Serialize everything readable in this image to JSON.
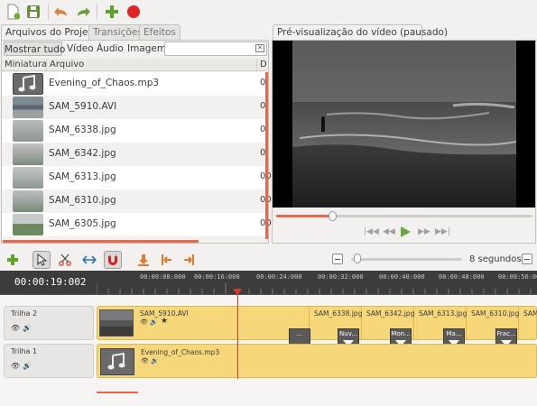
{
  "project_files": {
    "tabs": [
      "Arquivos do Projeto",
      "Transições",
      "Efeitos"
    ],
    "filters": [
      "Mostrar tudo",
      "Vídeo",
      "Áudio",
      "Imagem"
    ],
    "search_placeholder": "",
    "columns": [
      "Miniatura",
      "Arquivo",
      "D"
    ],
    "files": [
      {
        "name": "Evening_of_Chaos.mp3",
        "date": "0",
        "thumb": "audio-icon"
      },
      {
        "name": "SAM_5910.AVI",
        "date": "0",
        "thumb": "video"
      },
      {
        "name": "SAM_6338.jpg",
        "date": "0",
        "thumb": "image"
      },
      {
        "name": "SAM_6342.jpg",
        "date": "0",
        "thumb": "image"
      },
      {
        "name": "SAM_6313.jpg",
        "date": "00",
        "thumb": "image"
      },
      {
        "name": "SAM_6310.jpg",
        "date": "00",
        "thumb": "image"
      },
      {
        "name": "SAM_6305.jpg",
        "date": "00",
        "thumb": "image"
      }
    ]
  },
  "preview": {
    "tab_label": "Pré-visualização do vídeo (pausado)",
    "progress": 0.22
  },
  "timeline": {
    "current_time": "00:00:19:002",
    "zoom_label": "8 segundos",
    "zoom_level": 0.06,
    "ruler_marks": [
      "00:00:08:000",
      "00:00:16:000",
      "00:00:24:000",
      "00:00:32:000",
      "00:00:40:000",
      "00:00:48:000",
      "00:00:56:000"
    ],
    "tracks": [
      {
        "name": "Trilha 2",
        "clips": [
          "SAM_5910.AVI",
          "SAM_6338.jpg",
          "SAM_6342.jpg",
          "SAM_6313.jpg",
          "SAM_6310.jpg",
          "SAM_"
        ],
        "transitions": [
          "...",
          "Nuv...",
          "Mon...",
          "Ma...",
          "Frac..."
        ]
      },
      {
        "name": "Trilha 1",
        "clips": [
          "Evening_of_Chaos.mp3"
        ]
      }
    ]
  },
  "colors": {
    "accent": "#e9664b",
    "clip": "#f6d77a",
    "playhead": "#e3342f",
    "timeline_bg": "#3c3c3c"
  }
}
